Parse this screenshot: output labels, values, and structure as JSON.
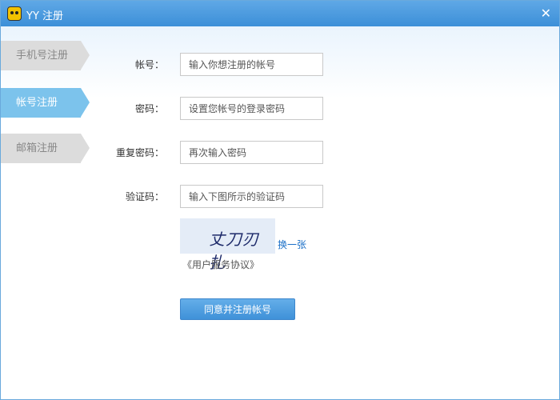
{
  "window": {
    "title": "YY 注册",
    "close_icon": "close-icon",
    "app_icon": "yy-logo-icon"
  },
  "sidebar": {
    "items": [
      {
        "label": "手机号注册",
        "active": false
      },
      {
        "label": "帐号注册",
        "active": true
      },
      {
        "label": "邮箱注册",
        "active": false
      }
    ]
  },
  "form": {
    "account": {
      "label": "帐号：",
      "placeholder": "输入你想注册的帐号"
    },
    "password": {
      "label": "密码：",
      "placeholder": "设置您帐号的登录密码"
    },
    "confirm_password": {
      "label": "重复密码：",
      "placeholder": "再次输入密码"
    },
    "captcha": {
      "label": "验证码：",
      "placeholder": "输入下图所示的验证码",
      "image_text": "丈刀刃扎",
      "refresh_label": "换一张"
    },
    "agreement_label": "《用户服务协议》",
    "submit_label": "同意并注册帐号"
  },
  "colors": {
    "accent": "#3f91d8",
    "active_tab": "#7cc3ec",
    "inactive_tab": "#dcdcdc",
    "link": "#1a6fc7"
  }
}
